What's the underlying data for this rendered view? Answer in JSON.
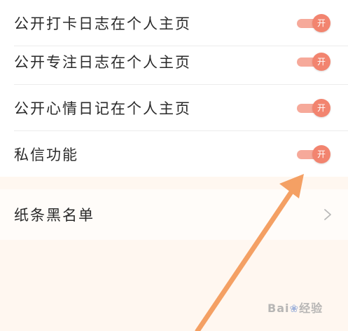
{
  "settings": [
    {
      "label": "公开打卡日志在个人主页",
      "toggle_text": "开",
      "enabled": true
    },
    {
      "label": "公开专注日志在个人主页",
      "toggle_text": "开",
      "enabled": true
    },
    {
      "label": "公开心情日记在个人主页",
      "toggle_text": "开",
      "enabled": true
    },
    {
      "label": "私信功能",
      "toggle_text": "开",
      "enabled": true
    }
  ],
  "blacklist": {
    "label": "纸条黑名单"
  },
  "icons": {
    "chevron": "chevron-right-icon",
    "arrow": "annotation-arrow-icon",
    "watermark_logo": "baidu-paw-icon"
  },
  "colors": {
    "accent": "#f2846f",
    "track": "#f6a99a",
    "annotation_arrow": "#f4a064",
    "background": "#fff7f0"
  },
  "watermark": {
    "text_left": "Bai",
    "text_right": "经验"
  }
}
